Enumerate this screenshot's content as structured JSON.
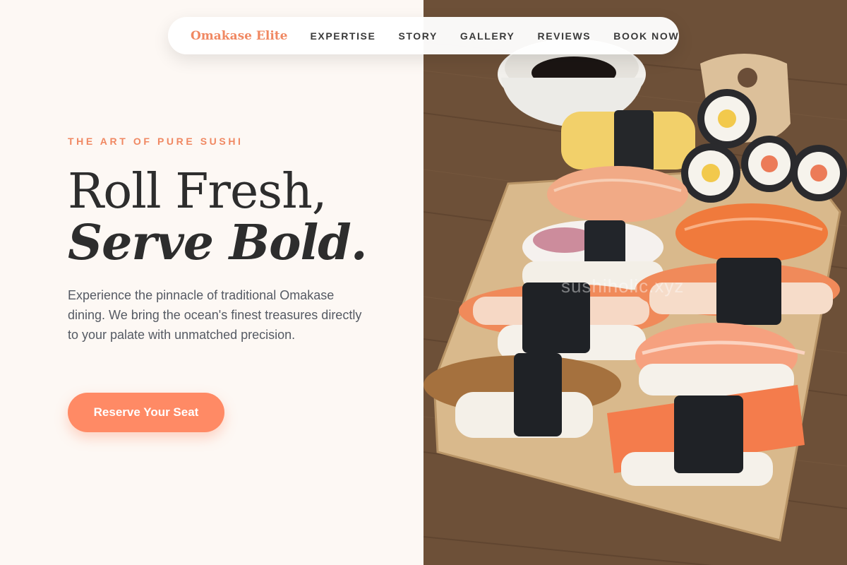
{
  "nav": {
    "brand": "Omakase Elite",
    "links": [
      "EXPERTISE",
      "STORY",
      "GALLERY",
      "REVIEWS",
      "BOOK NOW"
    ]
  },
  "hero": {
    "eyebrow": "THE ART OF PURE SUSHI",
    "headline_line1": "Roll Fresh,",
    "headline_line2": "Serve Bold.",
    "description": "Experience the pinnacle of traditional Omakase dining. We bring the ocean's finest treasures directly to your palate with unmatched precision.",
    "cta_label": "Reserve Your Seat"
  },
  "image": {
    "watermark": "sushiholic.xyz"
  },
  "colors": {
    "accent": "#ff8a65",
    "background": "#fdf8f4",
    "text_dark": "#2d2d2d"
  }
}
